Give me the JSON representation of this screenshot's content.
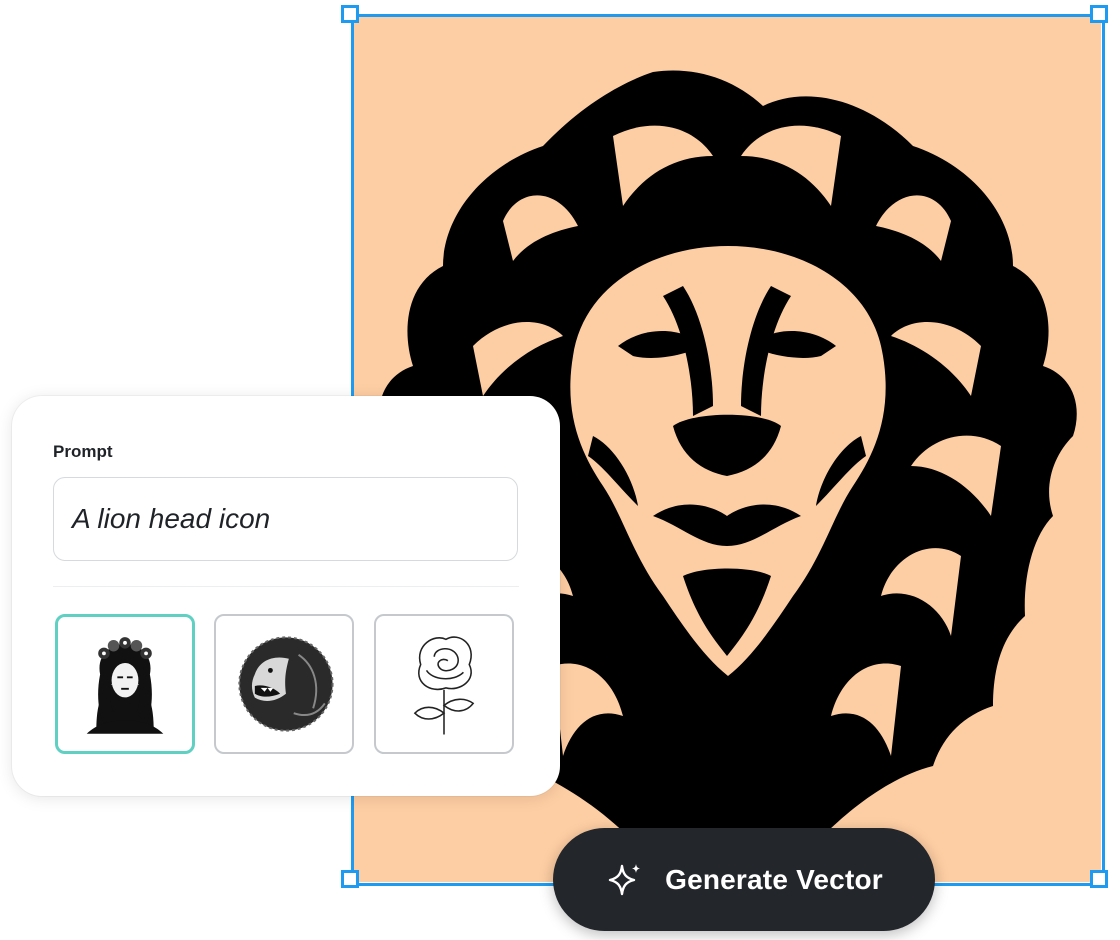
{
  "canvas": {
    "artwork_name": "lion-head-vector",
    "background_color": "#fdcda3",
    "selection_color": "#1e9bf0"
  },
  "prompt_card": {
    "label": "Prompt",
    "input_value": "A lion head icon",
    "style_references": [
      {
        "name": "woman-flower-crown-thumbnail",
        "selected": true
      },
      {
        "name": "roaring-lion-thumbnail",
        "selected": false
      },
      {
        "name": "rose-line-art-thumbnail",
        "selected": false
      }
    ],
    "selected_color": "#5fd0c2"
  },
  "generate_button": {
    "label": "Generate Vector",
    "icon": "sparkle-icon"
  }
}
